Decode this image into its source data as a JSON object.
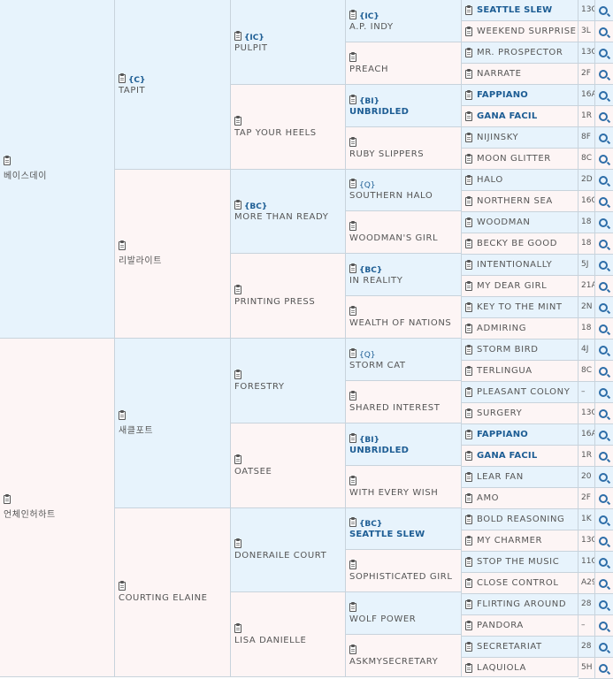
{
  "pedigree": {
    "g1": [
      {
        "name": "베이스데이",
        "side": "sire"
      },
      {
        "name": "언체인허하트",
        "side": "dam"
      }
    ],
    "g2": [
      {
        "tag": "{C}",
        "name": "TAPIT",
        "side": "sire"
      },
      {
        "tag": "",
        "name": "리발라이트",
        "side": "dam"
      },
      {
        "tag": "",
        "name": "새클포트",
        "side": "sire"
      },
      {
        "tag": "",
        "name": "COURTING ELAINE",
        "side": "dam"
      }
    ],
    "g3": [
      {
        "tag": "{IC}",
        "name": "PULPIT",
        "side": "sire"
      },
      {
        "tag": "",
        "name": "TAP YOUR HEELS",
        "side": "dam"
      },
      {
        "tag": "{BC}",
        "name": "MORE THAN READY",
        "side": "sire"
      },
      {
        "tag": "",
        "name": "PRINTING PRESS",
        "side": "dam"
      },
      {
        "tag": "",
        "name": "FORESTRY",
        "side": "sire"
      },
      {
        "tag": "",
        "name": "OATSEE",
        "side": "dam"
      },
      {
        "tag": "",
        "name": "DONERAILE COURT",
        "side": "sire"
      },
      {
        "tag": "",
        "name": "LISA DANIELLE",
        "side": "dam"
      }
    ],
    "g4": [
      {
        "tag": "{IC}",
        "name": "A.P. INDY",
        "side": "sire",
        "bold": false,
        "tag_light": false
      },
      {
        "tag": "",
        "name": "PREACH",
        "side": "dam",
        "bold": false
      },
      {
        "tag": "{BI}",
        "name": "UNBRIDLED",
        "side": "sire",
        "bold": true
      },
      {
        "tag": "",
        "name": "RUBY SLIPPERS",
        "side": "dam",
        "bold": false
      },
      {
        "tag": "{Q}",
        "name": "SOUTHERN HALO",
        "side": "sire",
        "bold": false,
        "tag_light": true
      },
      {
        "tag": "",
        "name": "WOODMAN'S GIRL",
        "side": "dam",
        "bold": false
      },
      {
        "tag": "{BC}",
        "name": "IN REALITY",
        "side": "sire",
        "bold": false
      },
      {
        "tag": "",
        "name": "WEALTH OF NATIONS",
        "side": "dam",
        "bold": false
      },
      {
        "tag": "{Q}",
        "name": "STORM CAT",
        "side": "sire",
        "bold": false,
        "tag_light": true
      },
      {
        "tag": "",
        "name": "SHARED INTEREST",
        "side": "dam",
        "bold": false
      },
      {
        "tag": "{BI}",
        "name": "UNBRIDLED",
        "side": "sire",
        "bold": true
      },
      {
        "tag": "",
        "name": "WITH EVERY WISH",
        "side": "dam",
        "bold": false
      },
      {
        "tag": "{BC}",
        "name": "SEATTLE SLEW",
        "side": "sire",
        "bold": true
      },
      {
        "tag": "",
        "name": "SOPHISTICATED GIRL",
        "side": "dam",
        "bold": false
      },
      {
        "tag": "",
        "name": "WOLF POWER",
        "side": "sire",
        "bold": false
      },
      {
        "tag": "",
        "name": "ASKMYSECRETARY",
        "side": "dam",
        "bold": false
      }
    ],
    "g5": [
      {
        "name": "SEATTLE SLEW",
        "code": "13C",
        "side": "sire",
        "bold": true
      },
      {
        "name": "WEEKEND SURPRISE",
        "code": "3L",
        "side": "dam",
        "bold": false
      },
      {
        "name": "MR. PROSPECTOR",
        "code": "13C",
        "side": "sire",
        "bold": false
      },
      {
        "name": "NARRATE",
        "code": "2F",
        "side": "dam",
        "bold": false
      },
      {
        "name": "FAPPIANO",
        "code": "16A",
        "side": "sire",
        "bold": true
      },
      {
        "name": "GANA FACIL",
        "code": "1R",
        "side": "dam",
        "bold": true
      },
      {
        "name": "NIJINSKY",
        "code": "8F",
        "side": "sire",
        "bold": false
      },
      {
        "name": "MOON GLITTER",
        "code": "8C",
        "side": "dam",
        "bold": false
      },
      {
        "name": "HALO",
        "code": "2D",
        "side": "sire",
        "bold": false
      },
      {
        "name": "NORTHERN SEA",
        "code": "16C",
        "side": "dam",
        "bold": false
      },
      {
        "name": "WOODMAN",
        "code": "18",
        "side": "sire",
        "bold": false
      },
      {
        "name": "BECKY BE GOOD",
        "code": "18",
        "side": "dam",
        "bold": false
      },
      {
        "name": "INTENTIONALLY",
        "code": "5J",
        "side": "sire",
        "bold": false
      },
      {
        "name": "MY DEAR GIRL",
        "code": "21A",
        "side": "dam",
        "bold": false
      },
      {
        "name": "KEY TO THE MINT",
        "code": "2N",
        "side": "sire",
        "bold": false
      },
      {
        "name": "ADMIRING",
        "code": "18",
        "side": "dam",
        "bold": false
      },
      {
        "name": "STORM BIRD",
        "code": "4J",
        "side": "sire",
        "bold": false
      },
      {
        "name": "TERLINGUA",
        "code": "8C",
        "side": "dam",
        "bold": false
      },
      {
        "name": "PLEASANT COLONY",
        "code": "–",
        "side": "sire",
        "bold": false
      },
      {
        "name": "SURGERY",
        "code": "13C",
        "side": "dam",
        "bold": false
      },
      {
        "name": "FAPPIANO",
        "code": "16A",
        "side": "sire",
        "bold": true
      },
      {
        "name": "GANA FACIL",
        "code": "1R",
        "side": "dam",
        "bold": true
      },
      {
        "name": "LEAR FAN",
        "code": "20",
        "side": "sire",
        "bold": false
      },
      {
        "name": "AMO",
        "code": "2F",
        "side": "dam",
        "bold": false
      },
      {
        "name": "BOLD REASONING",
        "code": "1K",
        "side": "sire",
        "bold": false
      },
      {
        "name": "MY CHARMER",
        "code": "13C",
        "side": "dam",
        "bold": false
      },
      {
        "name": "STOP THE MUSIC",
        "code": "11C",
        "side": "sire",
        "bold": false
      },
      {
        "name": "CLOSE CONTROL",
        "code": "A29",
        "side": "dam",
        "bold": false
      },
      {
        "name": "FLIRTING AROUND",
        "code": "28",
        "side": "sire",
        "bold": false
      },
      {
        "name": "PANDORA",
        "code": "–",
        "side": "dam",
        "bold": false
      },
      {
        "name": "SECRETARIAT",
        "code": "28",
        "side": "sire",
        "bold": false
      },
      {
        "name": "LAQUIOLA",
        "code": "5H",
        "side": "dam",
        "bold": false
      }
    ],
    "icons": {
      "doc": "clipboard-icon",
      "search": "magnifier-icon"
    },
    "colors": {
      "sire_bg": "#e7f3fc",
      "dam_bg": "#fdf5f5",
      "link": "#1d5d94",
      "border": "#c8d3dc"
    }
  }
}
